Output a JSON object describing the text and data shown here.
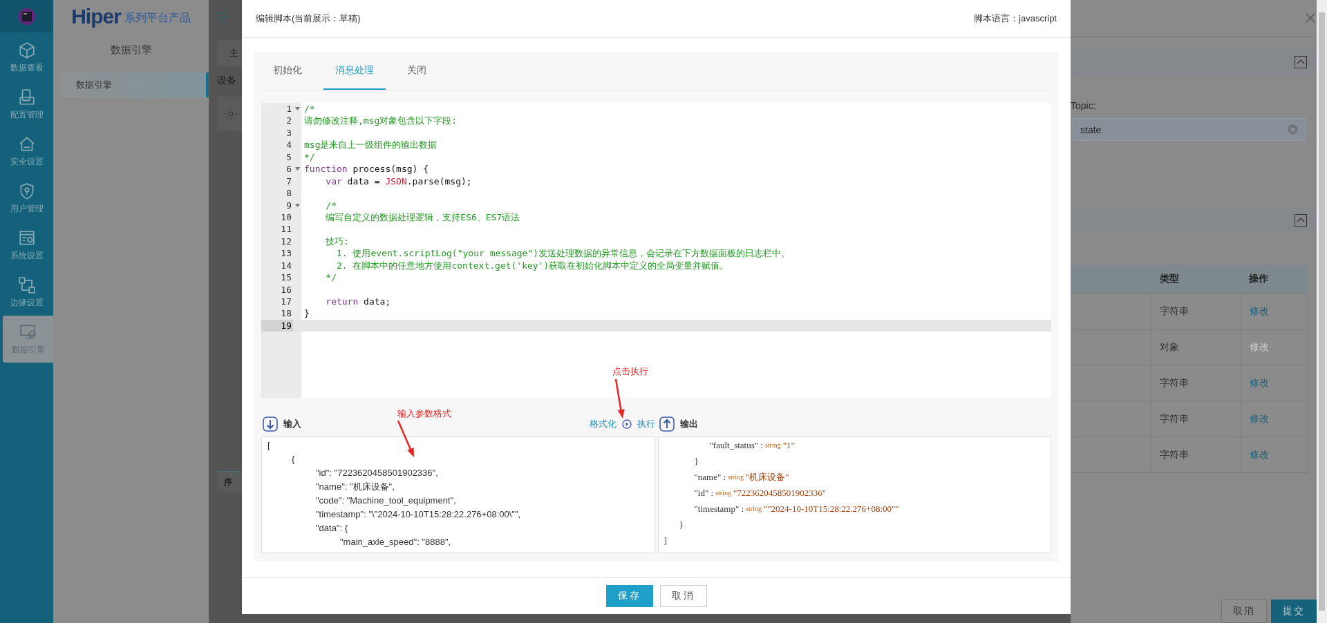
{
  "rail": {
    "items": [
      {
        "label": "数据查看",
        "selected": false
      },
      {
        "label": "配置管理",
        "selected": false
      },
      {
        "label": "安全设置",
        "selected": false
      },
      {
        "label": "用户管理",
        "selected": false
      },
      {
        "label": "系统设置",
        "selected": false
      },
      {
        "label": "边缘设置",
        "selected": false
      },
      {
        "label": "数据引擎",
        "selected": true
      }
    ]
  },
  "subnav": {
    "logo_text": "Hiper",
    "logo_subtitle": "系列平台产品",
    "title": "数据引擎",
    "items": [
      {
        "label": "数据引擎",
        "selected": true
      }
    ]
  },
  "background_page": {
    "tab": "主",
    "section_label": "设备",
    "table_header_cell": "序"
  },
  "drawer": {
    "topic_label": "Topic:",
    "topic_value": "state",
    "table": {
      "columns": [
        "类型",
        "操作"
      ],
      "rows": [
        {
          "type": "字符串",
          "action": "修改",
          "disabled": false
        },
        {
          "type": "对象",
          "action": "修改",
          "disabled": true
        },
        {
          "type": "字符串",
          "action": "修改",
          "disabled": false
        },
        {
          "type": "字符串",
          "action": "修改",
          "disabled": false
        },
        {
          "type": "字符串",
          "action": "修改",
          "disabled": false
        }
      ]
    },
    "buttons": [
      {
        "label": "取消",
        "kind": "default"
      },
      {
        "label": "提交",
        "kind": "primary"
      }
    ]
  },
  "dialog": {
    "title": "编辑脚本(当前展示：草稿)",
    "language": "脚本语言：javascript",
    "tabs": [
      {
        "label": "初始化",
        "selected": false
      },
      {
        "label": "消息处理",
        "selected": true
      },
      {
        "label": "关闭",
        "selected": false
      }
    ],
    "editor": {
      "lines": [
        {
          "number": "1",
          "fold": true,
          "active": false,
          "tokens": [
            {
              "kind": "comment",
              "text": "/*"
            }
          ]
        },
        {
          "number": "2",
          "fold": false,
          "active": false,
          "tokens": [
            {
              "kind": "comment",
              "text": "请勿修改注释,msg对象包含以下字段:"
            }
          ]
        },
        {
          "number": "3",
          "fold": false,
          "active": false
        },
        {
          "number": "4",
          "fold": false,
          "active": false,
          "tokens": [
            {
              "kind": "comment",
              "text": "msg是来自上一级组件的输出数据"
            }
          ]
        },
        {
          "number": "5",
          "fold": false,
          "active": false,
          "tokens": [
            {
              "kind": "comment",
              "text": "*/"
            }
          ]
        },
        {
          "number": "6",
          "fold": true,
          "active": false,
          "tokens": [
            {
              "kind": "keyword",
              "text": "function"
            },
            {
              "kind": "plain",
              "text": " process(msg) {"
            }
          ]
        },
        {
          "number": "7",
          "fold": false,
          "active": false,
          "tokens": [
            {
              "kind": "keyword",
              "text": "    var"
            },
            {
              "kind": "plain",
              "text": " data = "
            },
            {
              "kind": "builtin",
              "text": "JSON"
            },
            {
              "kind": "plain",
              "text": ".parse(msg);"
            }
          ]
        },
        {
          "number": "8",
          "fold": false,
          "active": false
        },
        {
          "number": "9",
          "fold": true,
          "active": false,
          "tokens": [
            {
              "kind": "comment",
              "text": "    /*"
            }
          ]
        },
        {
          "number": "10",
          "fold": false,
          "active": false,
          "tokens": [
            {
              "kind": "comment",
              "text": "    编写自定义的数据处理逻辑，支持ES6、ES7语法"
            }
          ]
        },
        {
          "number": "11",
          "fold": false,
          "active": false
        },
        {
          "number": "12",
          "fold": false,
          "active": false,
          "tokens": [
            {
              "kind": "comment",
              "text": "    技巧:"
            }
          ]
        },
        {
          "number": "13",
          "fold": false,
          "active": false,
          "tokens": [
            {
              "kind": "comment",
              "text": "      1. 使用event.scriptLog(\"your message\")发送处理数据的异常信息，会记录在下方数据面板的日志栏中。"
            }
          ]
        },
        {
          "number": "14",
          "fold": false,
          "active": false,
          "tokens": [
            {
              "kind": "comment",
              "text": "      2. 在脚本中的任意地方使用context.get('key')获取在初始化脚本中定义的全局变量并赋值。"
            }
          ]
        },
        {
          "number": "15",
          "fold": false,
          "active": false,
          "tokens": [
            {
              "kind": "comment",
              "text": "    */"
            }
          ]
        },
        {
          "number": "16",
          "fold": false,
          "active": false
        },
        {
          "number": "17",
          "fold": false,
          "active": false,
          "tokens": [
            {
              "kind": "keyword",
              "text": "    return"
            },
            {
              "kind": "plain",
              "text": " data;"
            }
          ]
        },
        {
          "number": "18",
          "fold": false,
          "active": false,
          "tokens": [
            {
              "kind": "plain",
              "text": "}"
            }
          ]
        },
        {
          "number": "19",
          "fold": false,
          "active": true
        }
      ]
    },
    "input": {
      "label": "输入",
      "value": "[\n\t{\n\t\t\"id\": \"7223620458501902336\",\n\t\t\"name\": \"机床设备\",\n\t\t\"code\": \"Machine_tool_equipment\",\n\t\t\"timestamp\": \"\\\"2024-10-10T15:28:22.276+08:00\\\"\",\n\t\t\"data\": {\n\t\t\t\"main_axle_speed\": \"8888\","
    },
    "format_link": "格式化",
    "run_link": "执行",
    "output": {
      "label": "输出",
      "separator": ":",
      "tree": {
        "close": "]",
        "children": [
          {
            "close": "}",
            "children": [
              {
                "close": "}",
                "children": [
                  {
                    "key": "\"fault_status\"",
                    "type": "string",
                    "value": "\"1\""
                  }
                ]
              },
              {
                "key": "\"name\"",
                "type": "string",
                "value": "\"机床设备\""
              },
              {
                "key": "\"id\"",
                "type": "string",
                "value": "\"7223620458501902336\""
              },
              {
                "key": "\"timestamp\"",
                "type": "string",
                "value": "\"\"2024-10-10T15:28:22.276+08:00\"\""
              }
            ]
          }
        ]
      }
    },
    "annotations": [
      {
        "text": "输入参数格式"
      },
      {
        "text": "点击执行"
      }
    ],
    "buttons": [
      {
        "label": "保存",
        "kind": "primary"
      },
      {
        "label": "取消",
        "kind": "default"
      }
    ]
  }
}
